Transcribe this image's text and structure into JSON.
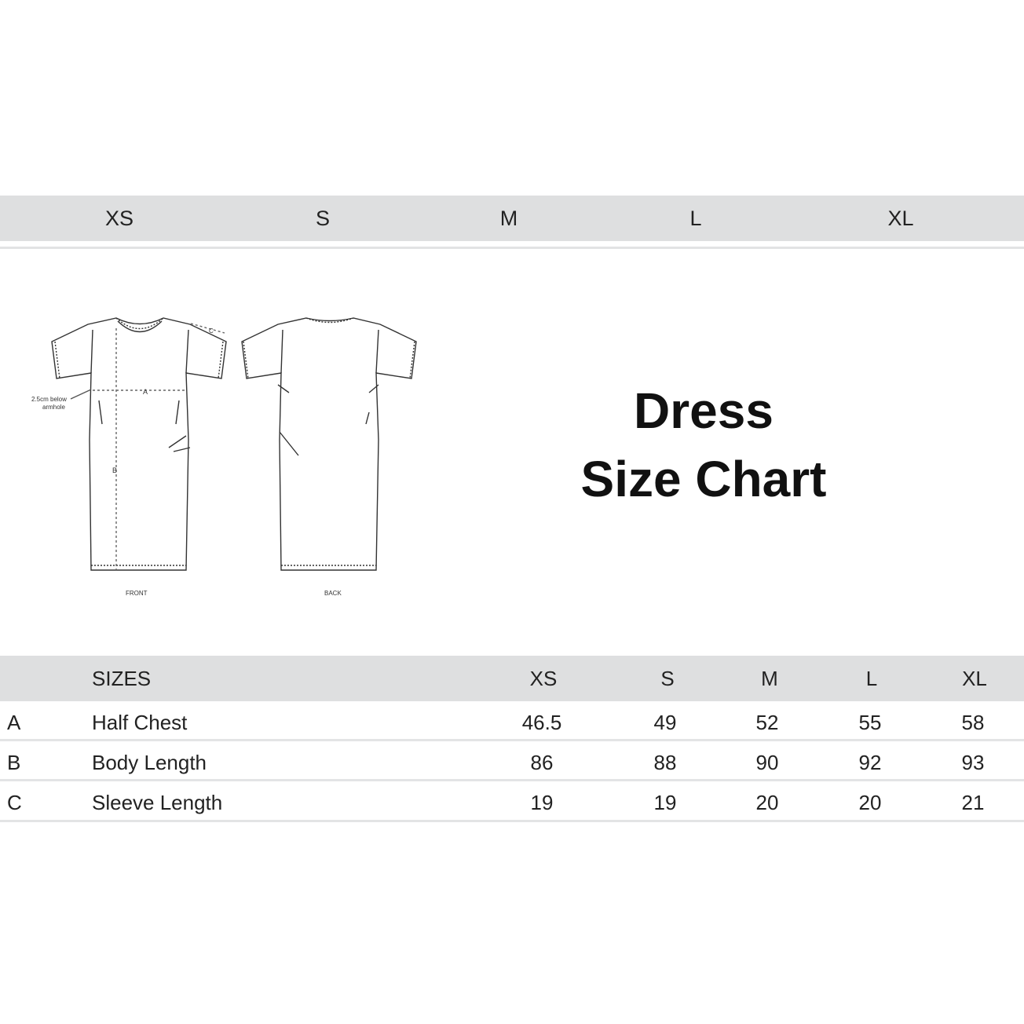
{
  "size_tabs": [
    "XS",
    "S",
    "M",
    "L",
    "XL"
  ],
  "illustration": {
    "front_label": "FRONT",
    "back_label": "BACK",
    "note_line1": "2.5cm below",
    "note_line2": "armhole",
    "marker_a": "A",
    "marker_b": "B",
    "marker_c": "C"
  },
  "title": {
    "line1": "Dress",
    "line2": "Size Chart"
  },
  "table": {
    "header": {
      "sizes_label": "SIZES",
      "sizes": [
        "XS",
        "S",
        "M",
        "L",
        "XL"
      ]
    },
    "rows": [
      {
        "code": "A",
        "name": "Half Chest",
        "values": [
          "46.5",
          "49",
          "52",
          "55",
          "58"
        ]
      },
      {
        "code": "B",
        "name": "Body Length",
        "values": [
          "86",
          "88",
          "90",
          "92",
          "93"
        ]
      },
      {
        "code": "C",
        "name": "Sleeve Length",
        "values": [
          "19",
          "19",
          "20",
          "20",
          "21"
        ]
      }
    ]
  }
}
